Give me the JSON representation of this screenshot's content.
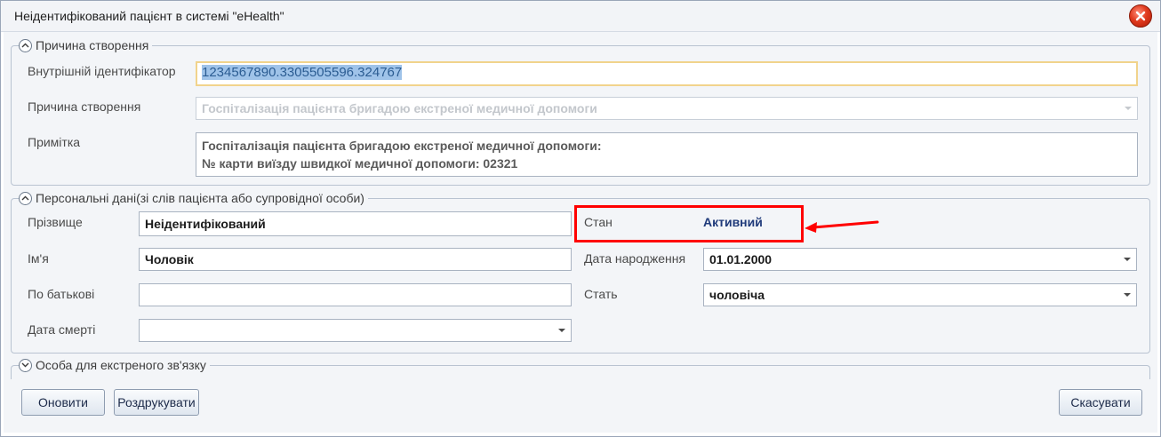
{
  "window": {
    "title": "Неідентифікований пацієнт в системі \"eHealth\""
  },
  "creation_group": {
    "title": "Причина створення",
    "internal_id_label": "Внутрішній ідентифікатор",
    "internal_id_value": "1234567890.3305505596.324767",
    "reason_label": "Причина створення",
    "reason_value": "Госпіталізація пацієнта бригадою екстреної медичної допомоги",
    "note_label": "Примітка",
    "note_line1": "Госпіталізація пацієнта бригадою екстреної медичної допомоги:",
    "note_line2": "№ карти виїзду швидкої медичної допомоги: 02321"
  },
  "personal_group": {
    "title": "Персональні дані(зі слів пацієнта або супровідної особи)",
    "surname_label": "Прізвище",
    "surname_value": "Неідентифікований",
    "name_label": "Ім'я",
    "name_value": "Чоловік",
    "patronymic_label": "По батькові",
    "patronymic_value": "",
    "death_date_label": "Дата смерті",
    "death_date_value": "",
    "status_label": "Стан",
    "status_value": "Активний",
    "birth_date_label": "Дата народження",
    "birth_date_value": "01.01.2000",
    "gender_label": "Стать",
    "gender_value": "чоловіча"
  },
  "emergency_group": {
    "title": "Особа для екстреного зв'язку"
  },
  "buttons": {
    "refresh": "Оновити",
    "print": "Роздрукувати",
    "cancel": "Скасувати"
  },
  "colors": {
    "annotation": "#ff0000",
    "status_text": "#1f3a7a",
    "selection": "#9fc3e9"
  }
}
